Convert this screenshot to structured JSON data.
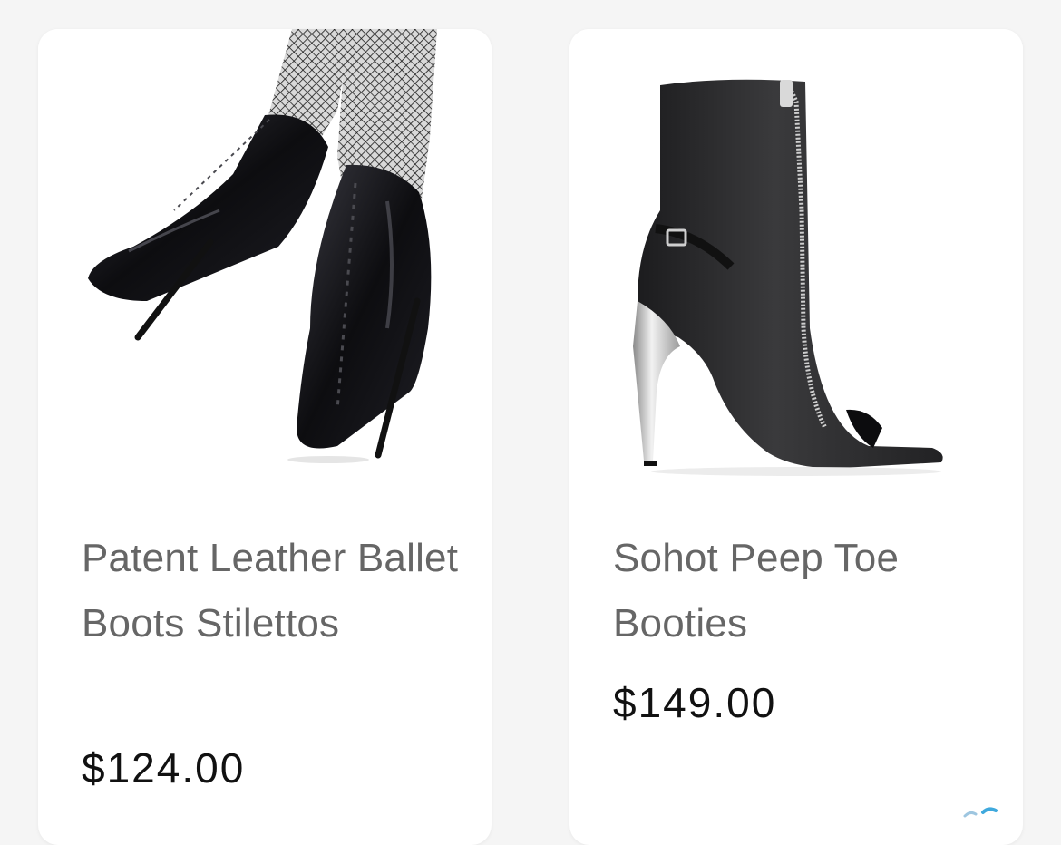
{
  "products": [
    {
      "title": "Patent Leather Ballet Boots Stilettos",
      "price": "$124.00",
      "image": "ballet-boots-image"
    },
    {
      "title": "Sohot Peep Toe Booties",
      "price": "$149.00",
      "image": "peep-toe-booties-image"
    }
  ],
  "colors": {
    "page_background": "#f5f5f5",
    "card_background": "#ffffff",
    "title_text": "#666666",
    "price_text": "#111111"
  }
}
